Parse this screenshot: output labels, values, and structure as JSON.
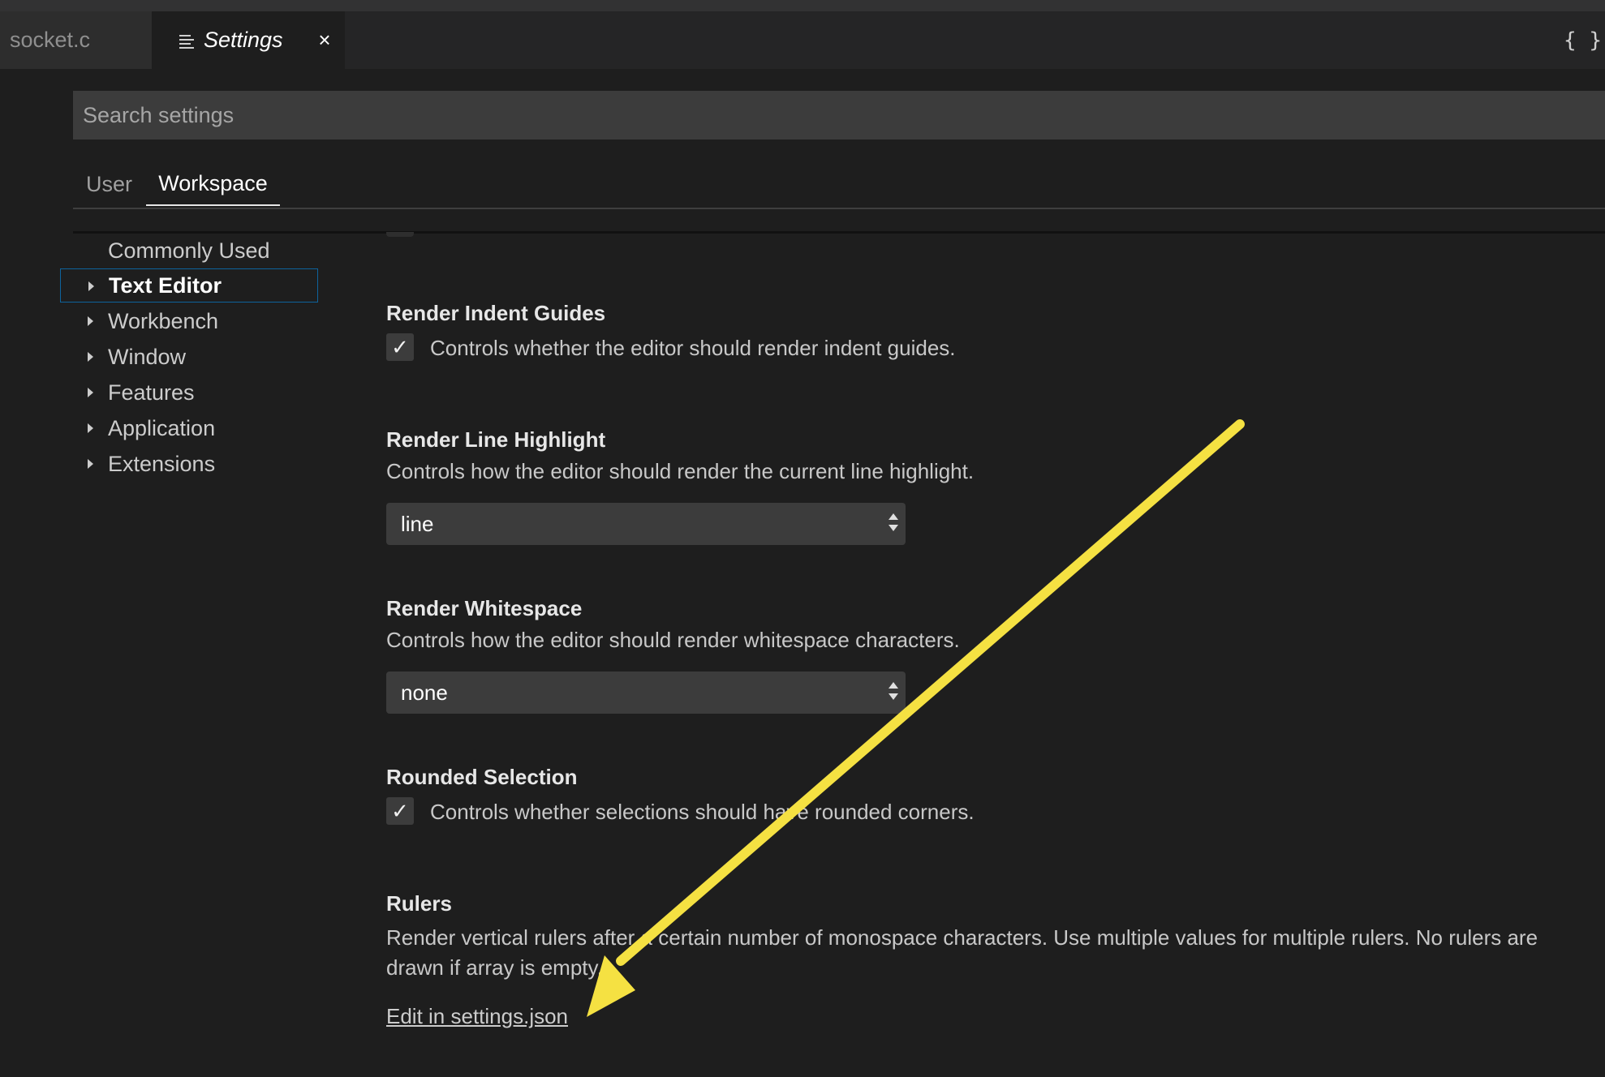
{
  "tabs": {
    "inactive_label": "socket.c",
    "active_label": "Settings",
    "close_symbol": "×",
    "braces_symbol": "{ }",
    "active_icon": "settings-lines-icon"
  },
  "search": {
    "placeholder": "Search settings",
    "value": ""
  },
  "scope_tabs": {
    "user": "User",
    "workspace": "Workspace",
    "selected": "Workspace"
  },
  "toc": {
    "commonly_used": "Commonly Used",
    "items": [
      "Text Editor",
      "Workbench",
      "Window",
      "Features",
      "Application",
      "Extensions"
    ],
    "selected": "Text Editor"
  },
  "settings": {
    "render_indent_guides": {
      "title": "Render Indent Guides",
      "description": "Controls whether the editor should render indent guides.",
      "checked": true
    },
    "render_line_highlight": {
      "title": "Render Line Highlight",
      "description": "Controls how the editor should render the current line highlight.",
      "value": "line"
    },
    "render_whitespace": {
      "title": "Render Whitespace",
      "description": "Controls how the editor should render whitespace characters.",
      "value": "none"
    },
    "rounded_selection": {
      "title": "Rounded Selection",
      "description": "Controls whether selections should have rounded corners.",
      "checked": true
    },
    "rulers": {
      "title": "Rulers",
      "description_line1": "Render vertical rulers after a certain number of monospace characters. Use multiple values for multiple rulers. No rulers are",
      "description_line2": "drawn if array is empty.",
      "link": "Edit in settings.json"
    }
  },
  "colors": {
    "background": "#1e1e1e",
    "input_background": "#3c3c3c",
    "focus_border": "#0e639c",
    "annotation_arrow": "#f5e142"
  },
  "annotation": {
    "type": "arrow",
    "color": "#f5e142"
  }
}
